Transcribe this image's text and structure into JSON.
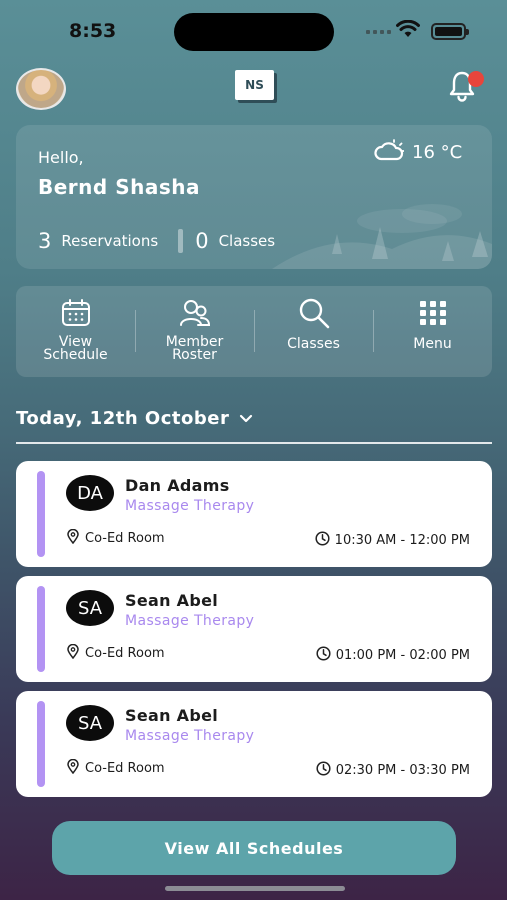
{
  "status_bar": {
    "time": "8:53"
  },
  "header": {
    "logo_text": "NS",
    "avatar_icon": "user-avatar",
    "notification_icon": "bell-icon"
  },
  "greeting": {
    "hello": "Hello,",
    "user_name": "Bernd Shasha",
    "weather_icon": "cloud-sun-icon",
    "temperature": "16 °C",
    "reservations_count": "3",
    "reservations_label": "Reservations",
    "classes_count": "0",
    "classes_label": "Classes"
  },
  "actions": [
    {
      "icon": "calendar-icon",
      "label": "View\nSchedule"
    },
    {
      "icon": "users-icon",
      "label": "Member\nRoster"
    },
    {
      "icon": "search-icon",
      "label": "Classes"
    },
    {
      "icon": "grid-icon",
      "label": "Menu"
    }
  ],
  "date_selector": {
    "label": "Today, 12th October",
    "icon": "chevron-down-icon"
  },
  "appointments": [
    {
      "initials": "DA",
      "name": "Dan Adams",
      "service": "Massage Therapy",
      "location": "Co-Ed Room",
      "time": "10:30 AM - 12:00 PM"
    },
    {
      "initials": "SA",
      "name": "Sean Abel",
      "service": "Massage Therapy",
      "location": "Co-Ed Room",
      "time": "01:00 PM - 02:00 PM"
    },
    {
      "initials": "SA",
      "name": "Sean Abel",
      "service": "Massage Therapy",
      "location": "Co-Ed Room",
      "time": "02:30 PM - 03:30 PM"
    }
  ],
  "footer": {
    "view_all_label": "View All Schedules"
  },
  "colors": {
    "accent": "#5da4aa",
    "service_text": "#a989ee",
    "appointment_bar": "#b393f3",
    "notification_dot": "#e8453b"
  }
}
